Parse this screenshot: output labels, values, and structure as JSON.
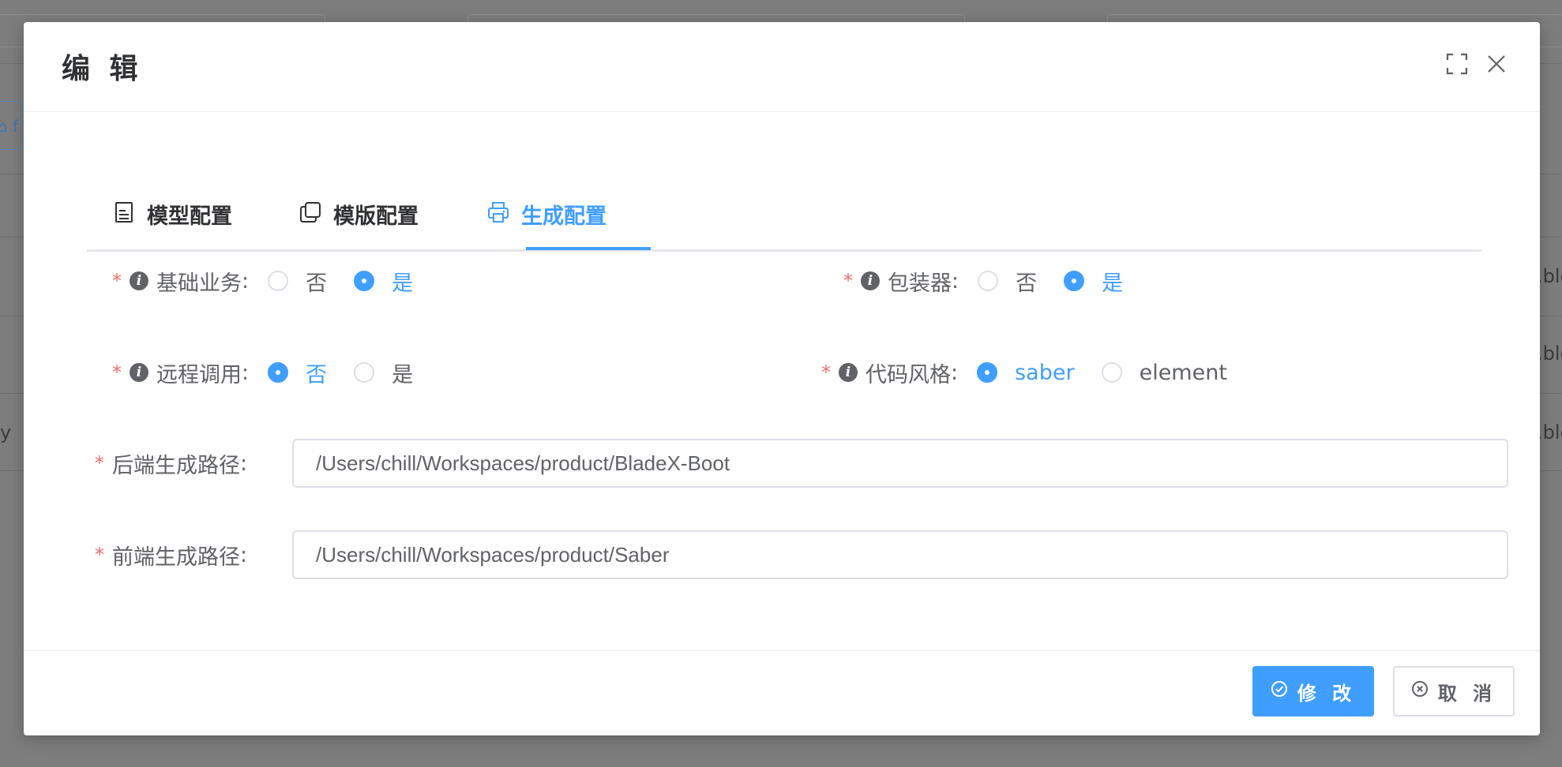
{
  "background": {
    "left_button_text": "⌂ f",
    "right_row_texts": [
      ".blc",
      ".blc",
      ".blc"
    ],
    "left_row_text": "y"
  },
  "dialog": {
    "title": "编 辑"
  },
  "tabs": [
    {
      "label": "模型配置",
      "icon": "document-icon"
    },
    {
      "label": "模版配置",
      "icon": "copy-icon"
    },
    {
      "label": "生成配置",
      "icon": "printer-icon",
      "active": true
    }
  ],
  "form": {
    "base_business": {
      "label": "基础业务",
      "options": [
        "否",
        "是"
      ],
      "selected": "是"
    },
    "wrapper": {
      "label": "包装器",
      "options": [
        "否",
        "是"
      ],
      "selected": "是"
    },
    "remote_call": {
      "label": "远程调用",
      "options": [
        "否",
        "是"
      ],
      "selected": "否"
    },
    "code_style": {
      "label": "代码风格",
      "options": [
        "saber",
        "element"
      ],
      "selected": "saber"
    },
    "backend_path": {
      "label": "后端生成路径",
      "value": "/Users/chill/Workspaces/product/BladeX-Boot"
    },
    "frontend_path": {
      "label": "前端生成路径",
      "value": "/Users/chill/Workspaces/product/Saber"
    }
  },
  "footer": {
    "submit_label": "修 改",
    "cancel_label": "取 消"
  },
  "colors": {
    "primary": "#409eff",
    "required": "#f56c6c",
    "text": "#606266"
  }
}
